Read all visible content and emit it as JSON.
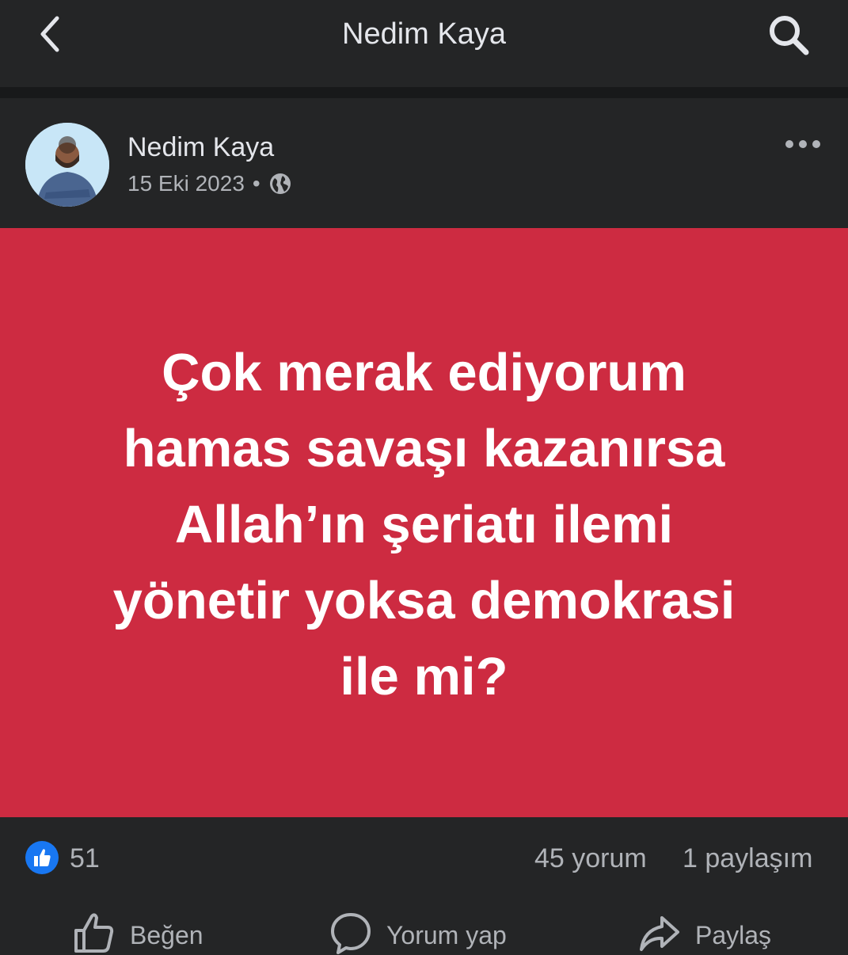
{
  "header": {
    "title": "Nedim Kaya"
  },
  "post": {
    "author": "Nedim Kaya",
    "date": "15 Eki 2023",
    "separator": "•",
    "privacy_icon": "globe-icon",
    "text_lines": [
      "Çok merak ediyorum",
      "hamas savaşı kazanırsa",
      "Allah’ın şeriatı ilemi",
      "yönetir yoksa demokrasi",
      "ile mi?"
    ],
    "background_color": "#cd2b41"
  },
  "stats": {
    "likes": "51",
    "comments": "45 yorum",
    "shares": "1 paylaşım"
  },
  "actions": {
    "like_label": "Beğen",
    "comment_label": "Yorum yap",
    "share_label": "Paylaş"
  },
  "colors": {
    "accent": "#1877f2",
    "background": "#242526",
    "divider": "#18191a"
  }
}
